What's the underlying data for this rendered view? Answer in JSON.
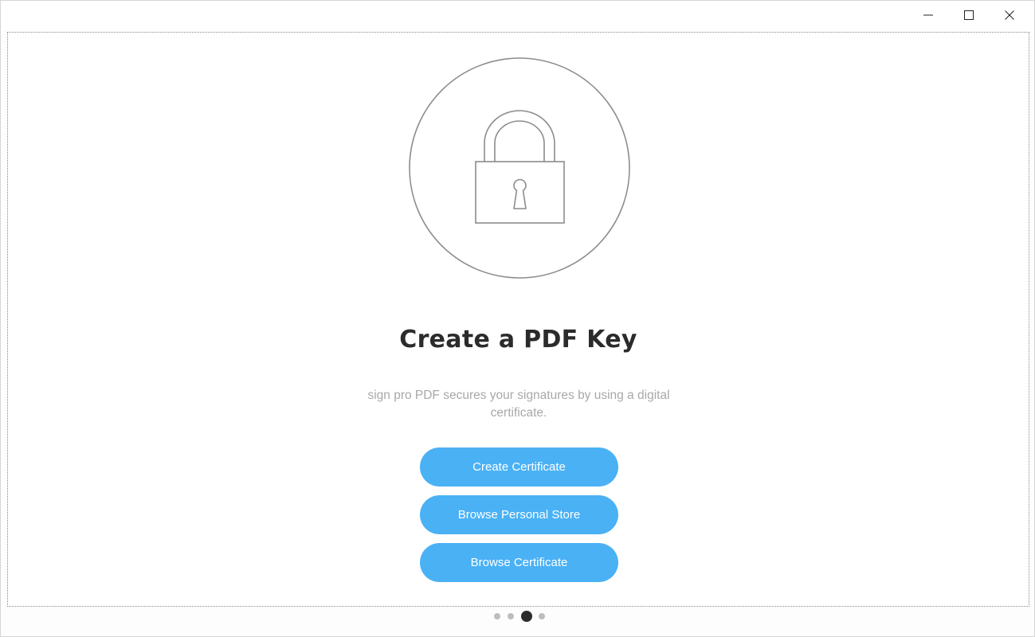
{
  "window": {
    "controls": {
      "minimize_icon": "minimize-icon",
      "maximize_icon": "maximize-icon",
      "close_icon": "close-icon"
    }
  },
  "main": {
    "hero_icon": "padlock-icon",
    "title": "Create a PDF Key",
    "description": "sign pro PDF secures your signatures by using a digital certificate.",
    "buttons": {
      "create_certificate": "Create Certificate",
      "browse_personal_store": "Browse Personal Store",
      "browse_certificate": "Browse Certificate"
    },
    "button_color": "#4ab1f5"
  },
  "pager": {
    "total_pages": 4,
    "active_page": 3
  }
}
